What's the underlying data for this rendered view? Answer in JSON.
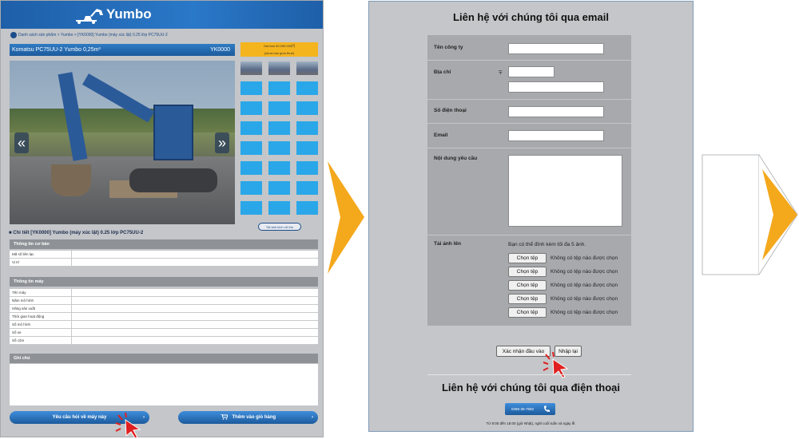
{
  "left": {
    "brand": "Yumbo",
    "breadcrumb": "Danh sách sản phẩm > Yumbo > [YK0000] Yumbo (máy xúc lật) 0.25 lớp PC75UU-2",
    "title": "Komatsu PC75UU-2 Yumbo 0,25m³",
    "code": "YK0000",
    "price_line1": "Giá bán 00.000.000円",
    "price_line2": "(chưa bao gồm thuế)",
    "zoom_label": "Tải ảnh kích cỡ lớn",
    "detail_heading": "Chi tiết [YK0000] Yumbo (máy xúc lật) 0.25 lớp PC75UU-2",
    "basic_section": "Thông tin cơ bản",
    "basic_rows": [
      "Mã số liên lạc",
      "Vị trí"
    ],
    "machine_section": "Thông tin máy",
    "machine_rows": [
      "Tên máy",
      "Năm mô hình",
      "Hãng sản xuất",
      "Thời gian hoạt động",
      "Số mô hình",
      "Số xe",
      "Số cộm"
    ],
    "notes_section": "Ghi chú",
    "inquiry_button": "Yêu cầu hỏi về máy này",
    "cart_button": "Thêm vào giỏ hàng",
    "cart_icon": "cart-icon",
    "prev_glyph": "«",
    "next_glyph": "»",
    "chevron_glyph": "›"
  },
  "mid": {
    "email_heading": "Liên hệ với chúng tôi qua email",
    "company_label": "Tên công ty",
    "address_label": "Địa chỉ",
    "postal_mark": "〒",
    "phone_label": "Số điện thoại",
    "email_label": "Email",
    "content_label": "Nội dung yêu cầu",
    "upload_label": "Tải ảnh lên",
    "upload_note": "Bạn có thể đính kèm tối đa 5 ảnh.",
    "choose_file": "Chọn tệp",
    "no_file": "Không có tệp nào được chọn",
    "file_slots": [
      1,
      2,
      3,
      4,
      5
    ],
    "confirm_button": "Xác nhận đầu vào",
    "reset_button": "Nhập lại",
    "phone_heading": "Liên hệ với chúng tôi qua điện thoại",
    "phone_number": "0285-36-7592",
    "phone_icon": "phone-icon",
    "hours": "Từ 9:00 đến 18:00 (giờ Nhật), nghỉ cuối tuần và ngày lễ."
  },
  "colors": {
    "accent": "#f4a81c",
    "brand_blue": "#1e5fa8",
    "tile_blue": "#2aa7e8",
    "panel_gray": "#c4c6c9",
    "cursor_red": "#e02020"
  }
}
